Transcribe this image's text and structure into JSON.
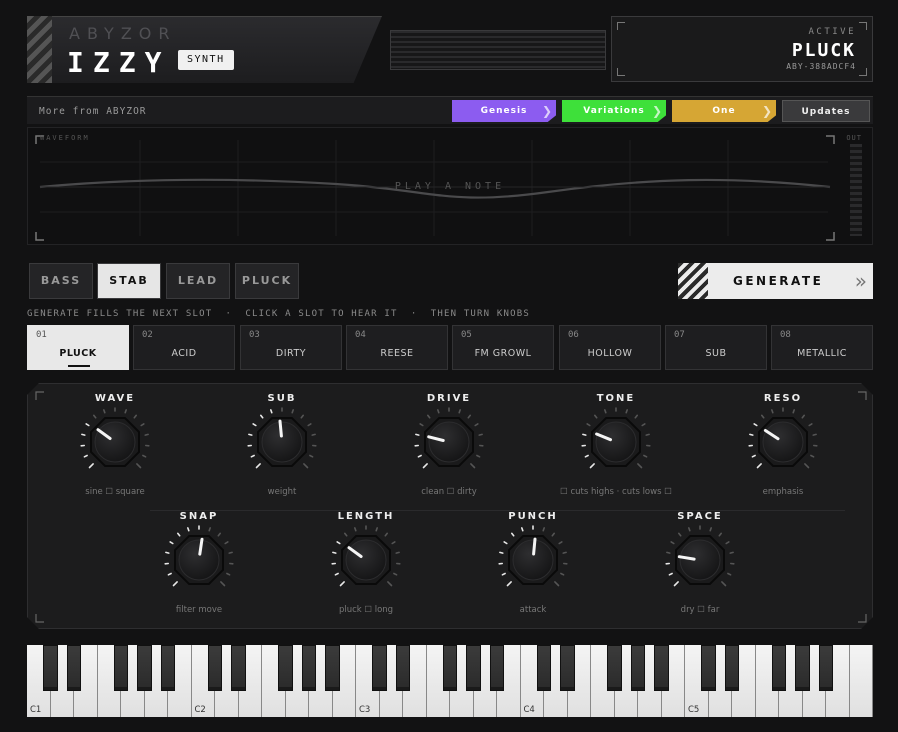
{
  "header": {
    "brand_sub": "ABYZOR",
    "brand_title": "IZZY",
    "badge": "SYNTH",
    "active_label": "ACTIVE",
    "active_name": "PLUCK",
    "active_id": "ABY-388ADCF4"
  },
  "more_bar": {
    "text": "More from ABYZOR",
    "links": [
      {
        "label": "Genesis",
        "color": "#8c5cf0"
      },
      {
        "label": "Variations",
        "color": "#3ee03a"
      },
      {
        "label": "One",
        "color": "#d6a634"
      },
      {
        "label": "Updates",
        "color": "#3a3a3c"
      }
    ]
  },
  "waveform": {
    "label": "WAVEFORM",
    "out_label": "OUT",
    "placeholder": "PLAY A NOTE"
  },
  "type_tabs": [
    {
      "label": "BASS",
      "active": false
    },
    {
      "label": "STAB",
      "active": true
    },
    {
      "label": "LEAD",
      "active": false
    },
    {
      "label": "PLUCK",
      "active": false
    }
  ],
  "generate_label": "GENERATE",
  "hint": "GENERATE FILLS THE NEXT SLOT  ·  CLICK A SLOT TO HEAR IT  ·  THEN TURN KNOBS",
  "slots": [
    {
      "num": "01",
      "name": "PLUCK",
      "active": true
    },
    {
      "num": "02",
      "name": "ACID",
      "active": false
    },
    {
      "num": "03",
      "name": "DIRTY",
      "active": false
    },
    {
      "num": "04",
      "name": "REESE",
      "active": false
    },
    {
      "num": "05",
      "name": "FM GROWL",
      "active": false
    },
    {
      "num": "06",
      "name": "HOLLOW",
      "active": false
    },
    {
      "num": "07",
      "name": "SUB",
      "active": false
    },
    {
      "num": "08",
      "name": "METALLIC",
      "active": false
    }
  ],
  "knobs_row1": [
    {
      "title": "WAVE",
      "sub": "sine ☐ square",
      "value": 0.3
    },
    {
      "title": "SUB",
      "sub": "weight",
      "value": 0.48
    },
    {
      "title": "DRIVE",
      "sub": "clean ☐ dirty",
      "value": 0.22
    },
    {
      "title": "TONE",
      "sub": "☐ cuts highs · cuts lows ☐",
      "value": 0.25
    },
    {
      "title": "RESO",
      "sub": "emphasis",
      "value": 0.29
    }
  ],
  "knobs_row2": [
    {
      "title": "SNAP",
      "sub": "filter move",
      "value": 0.53
    },
    {
      "title": "LENGTH",
      "sub": "pluck ☐ long",
      "value": 0.3
    },
    {
      "title": "PUNCH",
      "sub": "attack",
      "value": 0.52
    },
    {
      "title": "SPACE",
      "sub": "dry ☐ far",
      "value": 0.2
    }
  ],
  "keyboard": {
    "octave_labels": [
      "C1",
      "C2",
      "C3",
      "C4",
      "C5"
    ]
  }
}
